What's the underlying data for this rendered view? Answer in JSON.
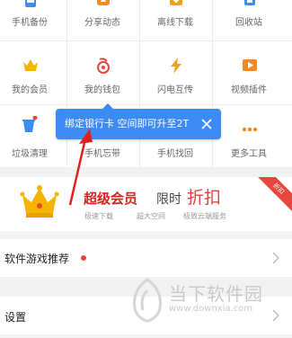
{
  "grid_items": [
    {
      "label": "手机备份",
      "icon": "phone-backup-icon",
      "color": "#3d8cf5"
    },
    {
      "label": "分享动态",
      "icon": "share-feed-icon",
      "color": "#f08a24"
    },
    {
      "label": "离线下载",
      "icon": "offline-download-icon",
      "color": "#f0a020"
    },
    {
      "label": "回收站",
      "icon": "recycle-bin-icon",
      "color": "#3d8cf5"
    },
    {
      "label": "我的会员",
      "icon": "crown-icon",
      "color": "#f5b400"
    },
    {
      "label": "我的钱包",
      "icon": "wallet-icon",
      "color": "#e8453c"
    },
    {
      "label": "闪电互传",
      "icon": "lightning-icon",
      "color": "#f0a020"
    },
    {
      "label": "视频插件",
      "icon": "video-plugin-icon",
      "color": "#f08a24"
    },
    {
      "label": "垃圾清理",
      "icon": "trash-clean-icon",
      "color": "#3d8cf5"
    },
    {
      "label": "手机忘带",
      "icon": "phone-forgotten-icon",
      "color": "#3d8cf5"
    },
    {
      "label": "手机找回",
      "icon": "phone-find-icon",
      "color": "#3d8cf5"
    },
    {
      "label": "更多工具",
      "icon": "more-tools-icon",
      "color": "#f08a24"
    }
  ],
  "tooltip": {
    "text": "绑定银行卡 空间即可升至2T",
    "close_icon": "close-icon"
  },
  "vip_banner": {
    "title": "超级会员",
    "limit": "限时",
    "discount": "折扣",
    "features": [
      "极速下载",
      "超大空间",
      "极致云端服务"
    ],
    "corner_tag": "折扣",
    "icon": "crown-icon"
  },
  "rows": [
    {
      "label": "软件游戏推荐",
      "has_dot": true
    },
    {
      "label": "设置",
      "has_dot": false
    }
  ],
  "watermark": {
    "title": "当下软件园",
    "url": "www.downxia.com"
  },
  "colors": {
    "accent": "#3d8cf5",
    "red": "#e8453c",
    "gold": "#f5b400"
  }
}
